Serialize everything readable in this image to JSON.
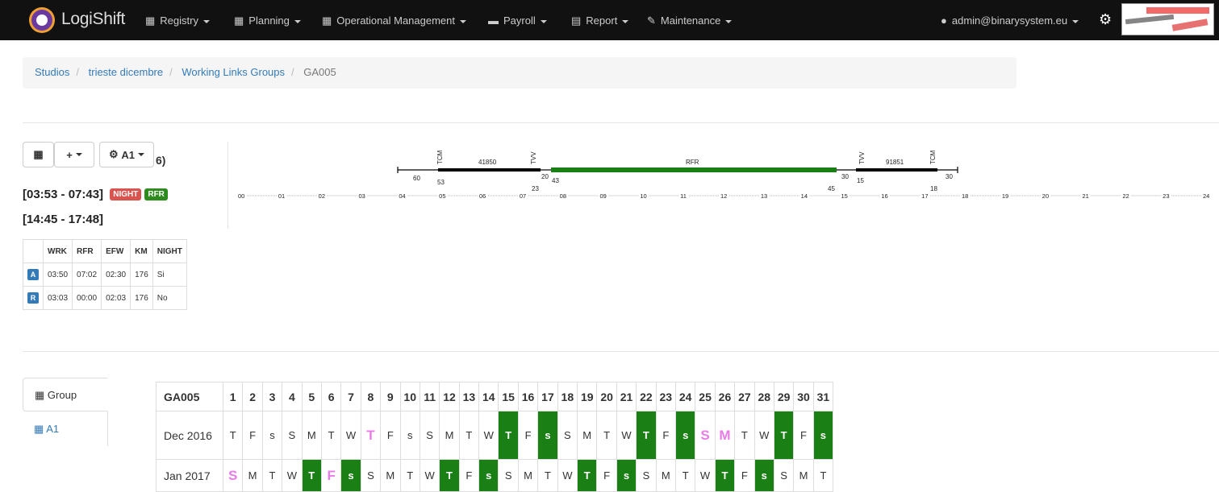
{
  "navbar": {
    "brand": "LogiShift",
    "items": [
      {
        "label": "Registry",
        "icon": "calendar-icon"
      },
      {
        "label": "Planning",
        "icon": "calendar-icon"
      },
      {
        "label": "Operational Management",
        "icon": "calendar-icon"
      },
      {
        "label": "Payroll",
        "icon": "briefcase-icon"
      },
      {
        "label": "Report",
        "icon": "file-icon"
      },
      {
        "label": "Maintenance",
        "icon": "wrench-icon"
      }
    ],
    "user": "admin@binarysystem.eu"
  },
  "breadcrumb": [
    "Studios",
    "trieste dicembre",
    "Working Links Groups",
    "GA005"
  ],
  "toolbar": {
    "group_label": "A1",
    "suffix": "6)"
  },
  "times": [
    {
      "range": "[03:53 - 07:43]",
      "badges": [
        "NIGHT",
        "RFR"
      ]
    },
    {
      "range": "[14:45 - 17:48]",
      "badges": []
    }
  ],
  "summary": {
    "headers": [
      "",
      "WRK",
      "RFR",
      "EFW",
      "KM",
      "NIGHT"
    ],
    "rows": [
      [
        "A",
        "03:50",
        "07:02",
        "02:30",
        "176",
        "Si"
      ],
      [
        "R",
        "03:03",
        "00:00",
        "02:03",
        "176",
        "No"
      ]
    ]
  },
  "timeline": {
    "ticks": [
      "00",
      "01",
      "02",
      "03",
      "04",
      "05",
      "06",
      "07",
      "08",
      "09",
      "10",
      "11",
      "12",
      "13",
      "14",
      "15",
      "16",
      "17",
      "18",
      "19",
      "20",
      "21",
      "22",
      "23",
      "24"
    ],
    "labels": {
      "tcm1": "TCM",
      "train1": "41850",
      "tvv1": "TVV",
      "rfr": "RFR",
      "tvv2": "TVV",
      "train2": "91851",
      "tcm2": "TCM",
      "n60": "60",
      "n53": "53",
      "n20": "20",
      "n23": "23",
      "n43": "43",
      "n45": "45",
      "n30a": "30",
      "n15": "15",
      "n18": "18",
      "n30b": "30"
    }
  },
  "tabs": [
    "Group",
    "A1"
  ],
  "calendar": {
    "group": "GA005",
    "days": [
      "1",
      "2",
      "3",
      "4",
      "5",
      "6",
      "7",
      "8",
      "9",
      "10",
      "11",
      "12",
      "13",
      "14",
      "15",
      "16",
      "17",
      "18",
      "19",
      "20",
      "21",
      "22",
      "23",
      "24",
      "25",
      "26",
      "27",
      "28",
      "29",
      "30",
      "31"
    ],
    "rows": [
      {
        "label": "Dec 2016",
        "cells": [
          {
            "v": "T"
          },
          {
            "v": "F"
          },
          {
            "v": "s"
          },
          {
            "v": "S"
          },
          {
            "v": "M"
          },
          {
            "v": "T"
          },
          {
            "v": "W"
          },
          {
            "v": "T",
            "c": "p"
          },
          {
            "v": "F"
          },
          {
            "v": "s"
          },
          {
            "v": "S"
          },
          {
            "v": "M"
          },
          {
            "v": "T"
          },
          {
            "v": "W"
          },
          {
            "v": "T",
            "c": "g"
          },
          {
            "v": "F"
          },
          {
            "v": "s",
            "c": "g"
          },
          {
            "v": "S"
          },
          {
            "v": "M"
          },
          {
            "v": "T"
          },
          {
            "v": "W"
          },
          {
            "v": "T",
            "c": "g"
          },
          {
            "v": "F"
          },
          {
            "v": "s",
            "c": "g"
          },
          {
            "v": "S",
            "c": "p"
          },
          {
            "v": "M",
            "c": "p"
          },
          {
            "v": "T"
          },
          {
            "v": "W"
          },
          {
            "v": "T",
            "c": "g"
          },
          {
            "v": "F"
          },
          {
            "v": "s",
            "c": "g"
          }
        ]
      },
      {
        "label": "Jan 2017",
        "cells": [
          {
            "v": "S",
            "c": "p"
          },
          {
            "v": "M"
          },
          {
            "v": "T"
          },
          {
            "v": "W"
          },
          {
            "v": "T",
            "c": "g"
          },
          {
            "v": "F",
            "c": "p"
          },
          {
            "v": "s",
            "c": "g"
          },
          {
            "v": "S"
          },
          {
            "v": "M"
          },
          {
            "v": "T"
          },
          {
            "v": "W"
          },
          {
            "v": "T",
            "c": "g"
          },
          {
            "v": "F"
          },
          {
            "v": "s",
            "c": "g"
          },
          {
            "v": "S"
          },
          {
            "v": "M"
          },
          {
            "v": "T"
          },
          {
            "v": "W"
          },
          {
            "v": "T",
            "c": "g"
          },
          {
            "v": "F"
          },
          {
            "v": "s",
            "c": "g"
          },
          {
            "v": "S"
          },
          {
            "v": "M"
          },
          {
            "v": "T"
          },
          {
            "v": "W"
          },
          {
            "v": "T",
            "c": "g"
          },
          {
            "v": "F"
          },
          {
            "v": "s",
            "c": "g"
          },
          {
            "v": "S"
          },
          {
            "v": "M"
          },
          {
            "v": "T"
          }
        ]
      }
    ]
  },
  "colors": {
    "navbar": "#111111",
    "green": "#1a7f14",
    "pink": "#e87ce6",
    "link": "#337ab7",
    "badge_red": "#d9534f"
  }
}
